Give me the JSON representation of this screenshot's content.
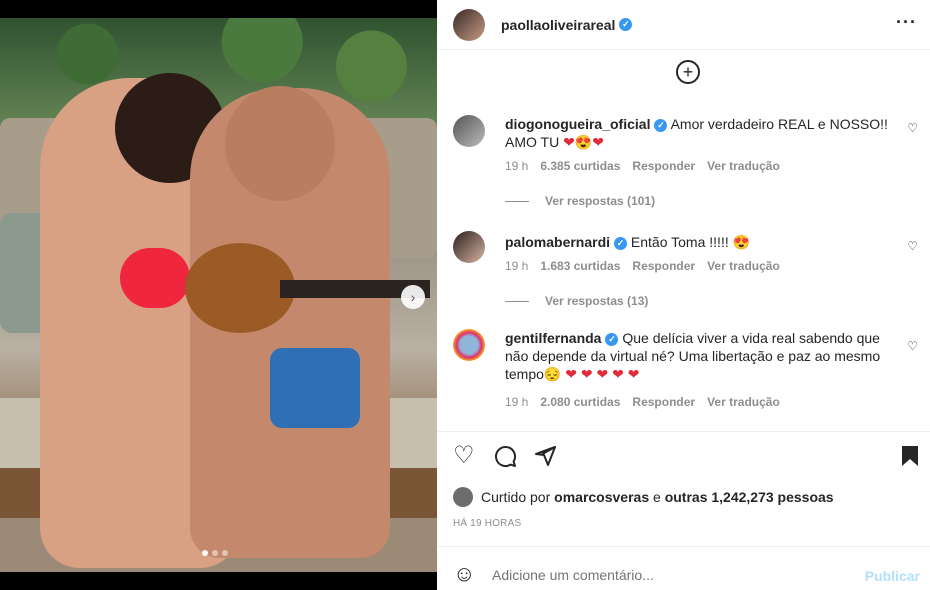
{
  "post": {
    "author": "paollaoliveirareal",
    "more_icon": "more-horizontal-icon",
    "carousel_next": "›",
    "carousel_count": 3,
    "carousel_active": 0
  },
  "comments": [
    {
      "user": "diogonogueira_oficial",
      "text": "Amor verdadeiro REAL e NOSSO!! AMO TU",
      "emojis": [
        "❤",
        "😍",
        "❤"
      ],
      "time": "19 h",
      "likes": "6.385 curtidas",
      "reply": "Responder",
      "translate": "Ver tradução",
      "view_replies": "Ver respostas (101)"
    },
    {
      "user": "palomabernardi",
      "text": "Então Toma !!!!!",
      "emojis": [
        "😍"
      ],
      "time": "19 h",
      "likes": "1.683 curtidas",
      "reply": "Responder",
      "translate": "Ver tradução",
      "view_replies": "Ver respostas (13)"
    },
    {
      "user": "gentilfernanda",
      "text": "Que delícia viver a vida real sabendo que não depende da virtual né? Uma libertação e paz ao mesmo tempo",
      "emojis": [
        "😔",
        "❤",
        "❤",
        "❤",
        "❤",
        "❤"
      ],
      "time": "19 h",
      "likes": "2.080 curtidas",
      "reply": "Responder",
      "translate": "Ver tradução"
    }
  ],
  "likes": {
    "prefix": "Curtido por",
    "user": "omarcosveras",
    "connector": "e",
    "others": "outras 1,242,273 pessoas"
  },
  "timestamp": "HÁ 19 HORAS",
  "composer": {
    "placeholder": "Adicione um comentário...",
    "post_label": "Publicar"
  },
  "colors": {
    "verified": "#3897f0",
    "meta_gray": "#8e8e8e",
    "post_disabled": "#b2dffc"
  }
}
